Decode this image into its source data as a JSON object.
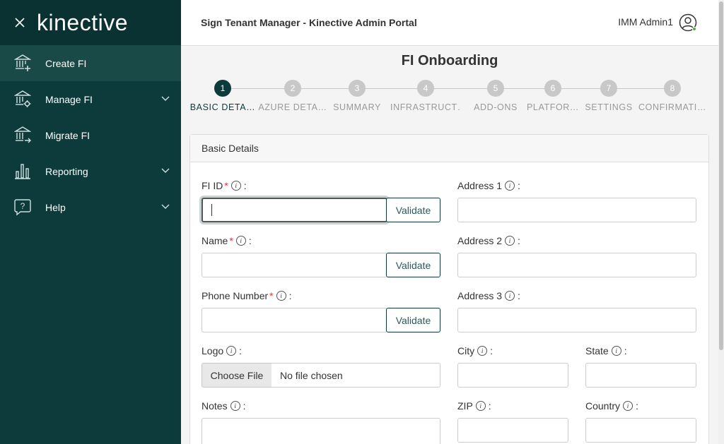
{
  "app": {
    "logo_text": "kinective",
    "header_title": "Sign Tenant Manager - Kinective Admin Portal",
    "user_name": "IMM Admin1"
  },
  "sidebar": {
    "items": [
      {
        "label": "Create FI",
        "icon": "bank-add-icon",
        "active": true
      },
      {
        "label": "Manage FI",
        "icon": "bank-gear-icon",
        "expandable": true
      },
      {
        "label": "Migrate FI",
        "icon": "bank-arrow-icon"
      },
      {
        "label": "Reporting",
        "icon": "bar-chart-icon",
        "expandable": true
      },
      {
        "label": "Help",
        "icon": "help-bubble-icon",
        "expandable": true
      }
    ]
  },
  "page": {
    "title": "FI Onboarding",
    "steps": [
      {
        "num": "1",
        "label": "BASIC DETA…"
      },
      {
        "num": "2",
        "label": "AZURE DETA…"
      },
      {
        "num": "3",
        "label": "SUMMARY"
      },
      {
        "num": "4",
        "label": "INFRASTRUCT…"
      },
      {
        "num": "5",
        "label": "ADD-ONS"
      },
      {
        "num": "6",
        "label": "PLATFOR…"
      },
      {
        "num": "7",
        "label": "SETTINGS"
      },
      {
        "num": "8",
        "label": "CONFIRMATI…"
      }
    ],
    "active_step": 1
  },
  "form": {
    "card_title": "Basic Details",
    "fi_id_label": "FI ID",
    "name_label": "Name",
    "phone_label": "Phone Number",
    "logo_label": "Logo",
    "notes_label": "Notes",
    "address1_label": "Address 1",
    "address2_label": "Address 2",
    "address3_label": "Address 3",
    "city_label": "City",
    "state_label": "State",
    "zip_label": "ZIP",
    "country_label": "Country",
    "required_mark": "*",
    "info_glyph": "i",
    "colon": ":",
    "validate_label": "Validate",
    "choose_file_label": "Choose File",
    "no_file_text": "No file chosen"
  },
  "colors": {
    "sidebar_bg": "#0d3b3b",
    "accent": "#0d3b3b",
    "required": "#d9363e",
    "online_dot": "#4caf50"
  }
}
